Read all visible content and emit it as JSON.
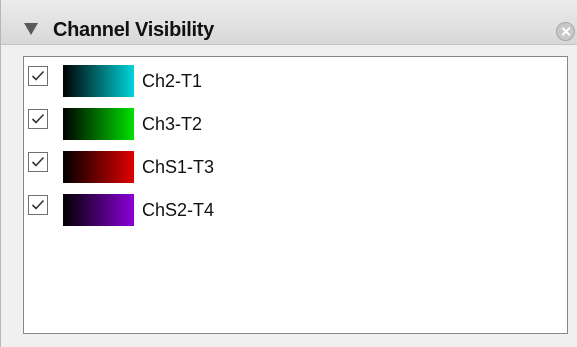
{
  "panel": {
    "title": "Channel Visibility",
    "collapse_icon": "triangle-down-icon",
    "close_icon": "close-circle-icon"
  },
  "channels": [
    {
      "label": "Ch2-T1",
      "checked": true,
      "color": "#00d4dc"
    },
    {
      "label": "Ch3-T2",
      "checked": true,
      "color": "#00e000"
    },
    {
      "label": "ChS1-T3",
      "checked": true,
      "color": "#e00000"
    },
    {
      "label": "ChS2-T4",
      "checked": true,
      "color": "#8c00d8"
    }
  ]
}
